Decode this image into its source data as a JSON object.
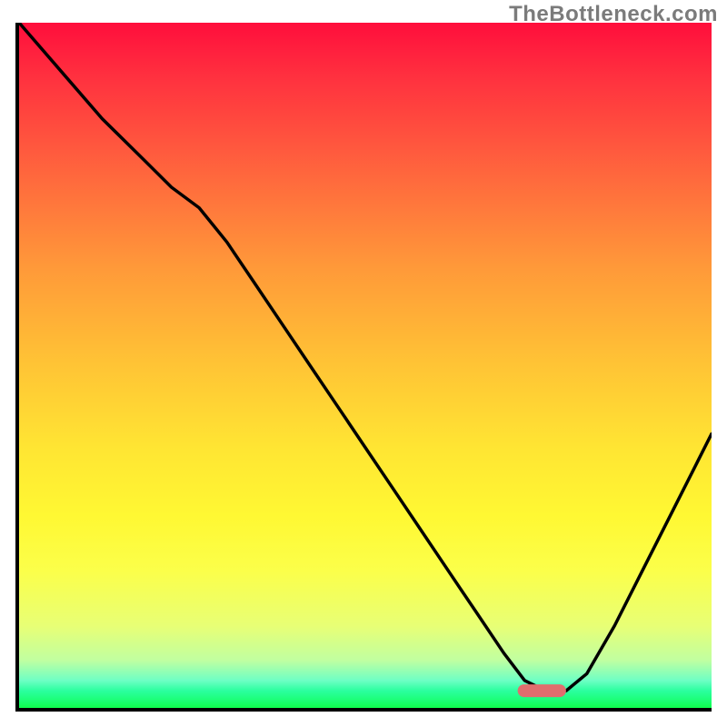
{
  "watermark": "TheBottleneck.com",
  "chart_data": {
    "type": "line",
    "title": "",
    "xlabel": "",
    "ylabel": "",
    "xlim": [
      0,
      100
    ],
    "ylim": [
      0,
      100
    ],
    "grid": false,
    "legend": false,
    "marker": {
      "color": "#e06e6e",
      "x_range": [
        72,
        79
      ],
      "y": 2.5,
      "shape": "rounded-bar"
    },
    "series": [
      {
        "name": "curve",
        "color": "#000000",
        "x": [
          0,
          6,
          12,
          18,
          22,
          26,
          30,
          34,
          38,
          42,
          46,
          50,
          54,
          58,
          62,
          66,
          70,
          73,
          76,
          79,
          82,
          86,
          90,
          94,
          98,
          100
        ],
        "y": [
          100,
          93,
          86,
          80,
          76,
          73,
          68,
          62,
          56,
          50,
          44,
          38,
          32,
          26,
          20,
          14,
          8,
          4,
          2.5,
          2.5,
          5,
          12,
          20,
          28,
          36,
          40
        ]
      }
    ]
  }
}
